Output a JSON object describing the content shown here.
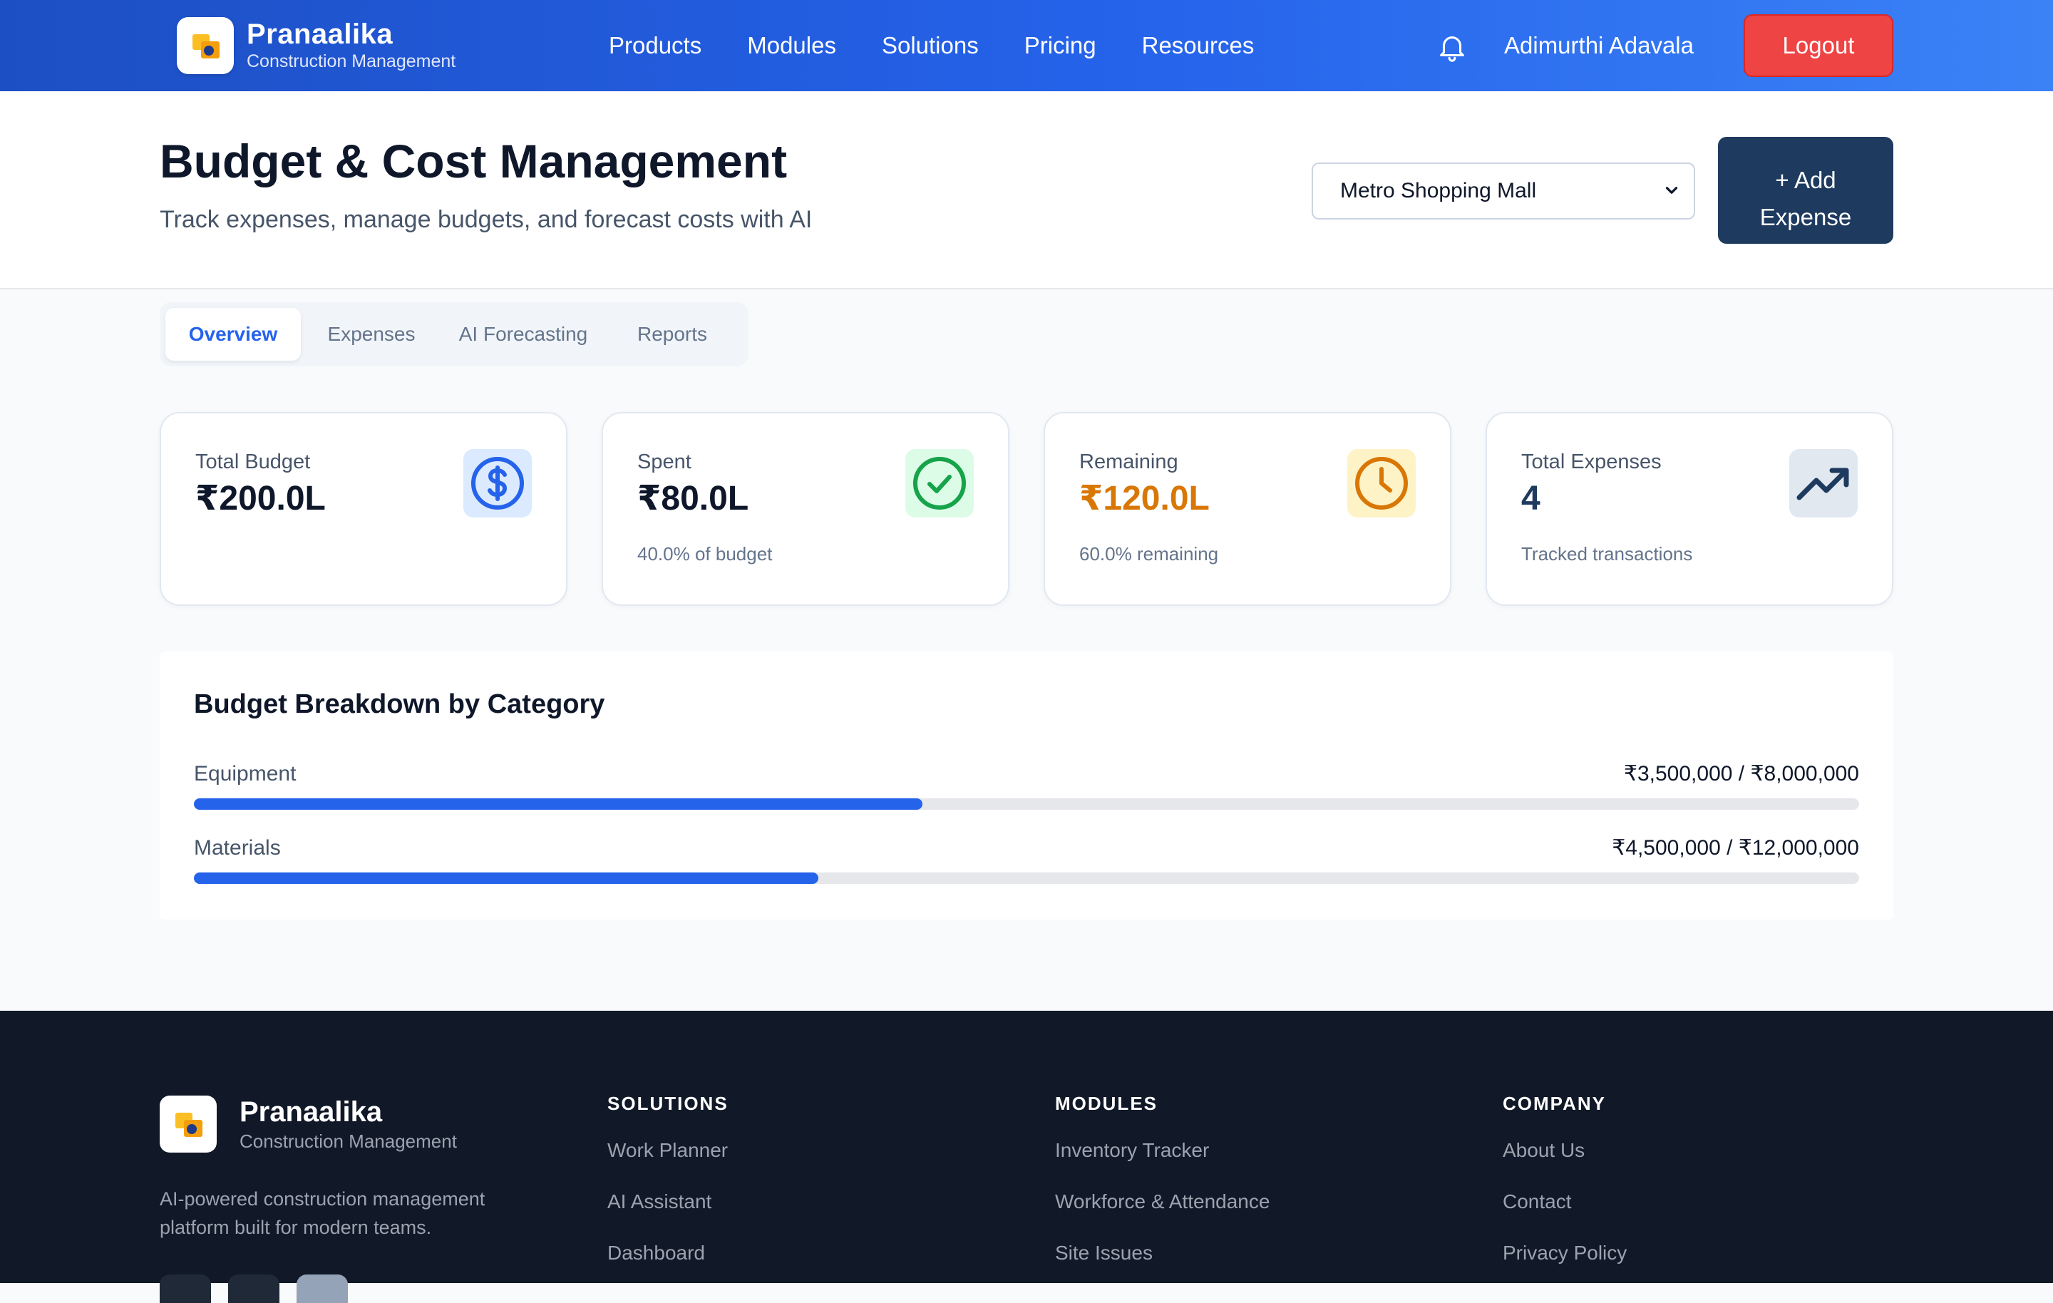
{
  "header": {
    "brand_name": "Pranaalika",
    "brand_sub": "Construction Management",
    "nav": [
      "Products",
      "Modules",
      "Solutions",
      "Pricing",
      "Resources"
    ],
    "user_name": "Adimurthi Adavala",
    "logout_label": "Logout",
    "bell_icon": "bell-icon"
  },
  "page": {
    "title": "Budget & Cost Management",
    "subtitle": "Track expenses, manage budgets, and forecast costs with AI",
    "project_selected": "Metro Shopping Mall",
    "add_expense_line1": "+ Add",
    "add_expense_line2": "Expense"
  },
  "tabs": [
    {
      "label": "Overview",
      "active": true
    },
    {
      "label": "Expenses",
      "active": false
    },
    {
      "label": "AI Forecasting",
      "active": false
    },
    {
      "label": "Reports",
      "active": false
    }
  ],
  "stats": [
    {
      "label": "Total Budget",
      "value": "₹200.0L",
      "note": "",
      "icon": "dollar-icon",
      "value_color": "#0f172a",
      "icon_bg": "#dbeafe",
      "icon_color": "#2563eb"
    },
    {
      "label": "Spent",
      "value": "₹80.0L",
      "note": "40.0% of budget",
      "icon": "check-circle-icon",
      "value_color": "#0f172a",
      "icon_bg": "#dcfce7",
      "icon_color": "#16a34a"
    },
    {
      "label": "Remaining",
      "value": "₹120.0L",
      "note": "60.0% remaining",
      "icon": "clock-icon",
      "value_color": "#d97706",
      "icon_bg": "#fef3c7",
      "icon_color": "#d97706"
    },
    {
      "label": "Total Expenses",
      "value": "4",
      "note": "Tracked transactions",
      "icon": "trending-up-icon",
      "value_color": "#1e3a5f",
      "icon_bg": "#e2e8f0",
      "icon_color": "#1e3a5f"
    }
  ],
  "breakdown": {
    "title": "Budget Breakdown by Category",
    "rows": [
      {
        "category": "Equipment",
        "amount": "₹3,500,000 / ₹8,000,000",
        "fraction": 0.4375
      },
      {
        "category": "Materials",
        "amount": "₹4,500,000 / ₹12,000,000",
        "fraction": 0.375
      }
    ]
  },
  "footer": {
    "brand_name": "Pranaalika",
    "brand_sub": "Construction Management",
    "description": "AI-powered construction management platform built for modern teams.",
    "columns": [
      {
        "heading": "SOLUTIONS",
        "links": [
          "Work Planner",
          "AI Assistant",
          "Dashboard"
        ]
      },
      {
        "heading": "MODULES",
        "links": [
          "Inventory Tracker",
          "Workforce & Attendance",
          "Site Issues"
        ]
      },
      {
        "heading": "COMPANY",
        "links": [
          "About Us",
          "Contact",
          "Privacy Policy"
        ]
      }
    ]
  },
  "colors": {
    "accent": "#2563eb",
    "header_gradient_start": "#1d4fc4",
    "header_gradient_end": "#3b82f6",
    "logout": "#ef4444",
    "add_button": "#1e3a5f",
    "footer_bg": "#111827"
  }
}
